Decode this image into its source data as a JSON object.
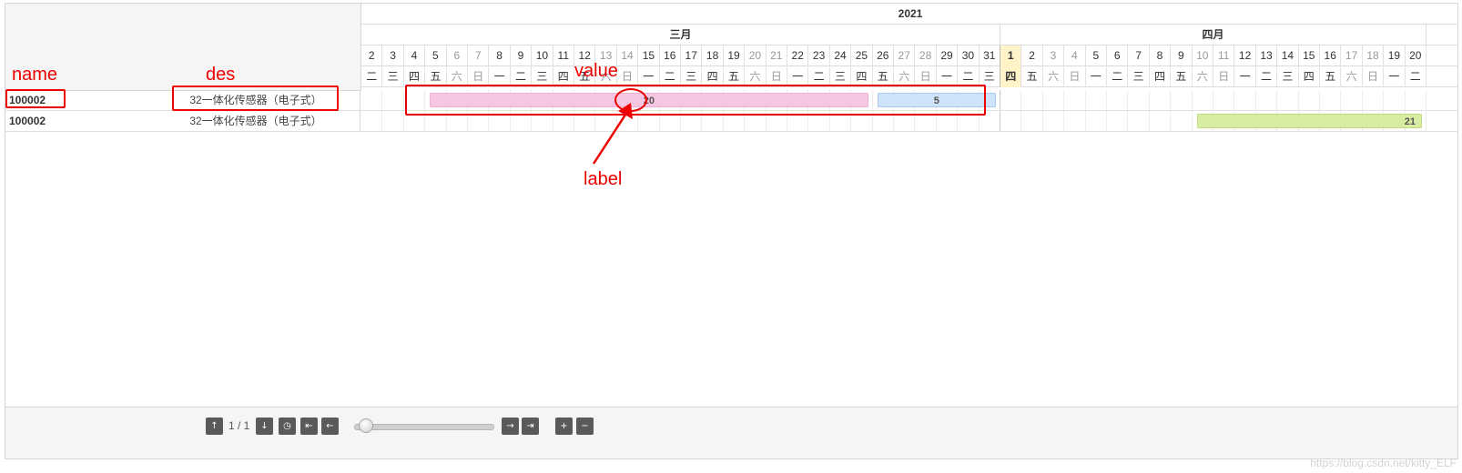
{
  "gantt": {
    "year": "2021",
    "months": [
      {
        "label": "三月"
      },
      {
        "label": "四月"
      }
    ],
    "days": [
      {
        "d": "2",
        "w": "二"
      },
      {
        "d": "3",
        "w": "三"
      },
      {
        "d": "4",
        "w": "四"
      },
      {
        "d": "5",
        "w": "五"
      },
      {
        "d": "6",
        "w": "六",
        "weekend": true
      },
      {
        "d": "7",
        "w": "日",
        "weekend": true
      },
      {
        "d": "8",
        "w": "一"
      },
      {
        "d": "9",
        "w": "二"
      },
      {
        "d": "10",
        "w": "三"
      },
      {
        "d": "11",
        "w": "四"
      },
      {
        "d": "12",
        "w": "五"
      },
      {
        "d": "13",
        "w": "六",
        "weekend": true
      },
      {
        "d": "14",
        "w": "日",
        "weekend": true
      },
      {
        "d": "15",
        "w": "一"
      },
      {
        "d": "16",
        "w": "二"
      },
      {
        "d": "17",
        "w": "三"
      },
      {
        "d": "18",
        "w": "四"
      },
      {
        "d": "19",
        "w": "五"
      },
      {
        "d": "20",
        "w": "六",
        "weekend": true
      },
      {
        "d": "21",
        "w": "日",
        "weekend": true
      },
      {
        "d": "22",
        "w": "一"
      },
      {
        "d": "23",
        "w": "二"
      },
      {
        "d": "24",
        "w": "三"
      },
      {
        "d": "25",
        "w": "四"
      },
      {
        "d": "26",
        "w": "五"
      },
      {
        "d": "27",
        "w": "六",
        "weekend": true
      },
      {
        "d": "28",
        "w": "日",
        "weekend": true
      },
      {
        "d": "29",
        "w": "一"
      },
      {
        "d": "30",
        "w": "二"
      },
      {
        "d": "31",
        "w": "三",
        "monthEnd": true
      },
      {
        "d": "1",
        "w": "四",
        "today": true
      },
      {
        "d": "2",
        "w": "五"
      },
      {
        "d": "3",
        "w": "六",
        "weekend": true
      },
      {
        "d": "4",
        "w": "日",
        "weekend": true
      },
      {
        "d": "5",
        "w": "一"
      },
      {
        "d": "6",
        "w": "二"
      },
      {
        "d": "7",
        "w": "三"
      },
      {
        "d": "8",
        "w": "四"
      },
      {
        "d": "9",
        "w": "五"
      },
      {
        "d": "10",
        "w": "六",
        "weekend": true
      },
      {
        "d": "11",
        "w": "日",
        "weekend": true
      },
      {
        "d": "12",
        "w": "一"
      },
      {
        "d": "13",
        "w": "二"
      },
      {
        "d": "14",
        "w": "三"
      },
      {
        "d": "15",
        "w": "四"
      },
      {
        "d": "16",
        "w": "五"
      },
      {
        "d": "17",
        "w": "六",
        "weekend": true
      },
      {
        "d": "18",
        "w": "日",
        "weekend": true
      },
      {
        "d": "19",
        "w": "一"
      },
      {
        "d": "20",
        "w": "二"
      }
    ],
    "rows": [
      {
        "name": "100002",
        "des": "32一体化传感器（电子式）",
        "bars": [
          {
            "label": "20",
            "color": "pink",
            "start": "2021-03-05",
            "end": "2021-03-25"
          },
          {
            "label": "5",
            "color": "blue",
            "start": "2021-03-26",
            "end": "2021-03-31"
          }
        ]
      },
      {
        "name": "100002",
        "des": "32一体化传感器（电子式）",
        "bars": [
          {
            "label": "21",
            "color": "green",
            "start": "2021-04-10",
            "end": "2021-04-20"
          }
        ]
      }
    ]
  },
  "footer": {
    "page_indicator": "1 / 1",
    "buttons": [
      "arrow-up",
      "arrow-down",
      "clock",
      "arrow-left-end",
      "arrow-left",
      "arrow-right",
      "arrow-right-end",
      "plus",
      "minus"
    ]
  },
  "annotations": {
    "name": "name",
    "des": "des",
    "value": "value",
    "label": "label"
  },
  "watermark": "https://blog.csdn.net/kitty_ELF",
  "colors": {
    "pink_bar": "#f7c6e2",
    "blue_bar": "#cfe3fa",
    "green_bar": "#d8eda1",
    "today": "#fff4c8",
    "annotation": "#ee0000"
  }
}
